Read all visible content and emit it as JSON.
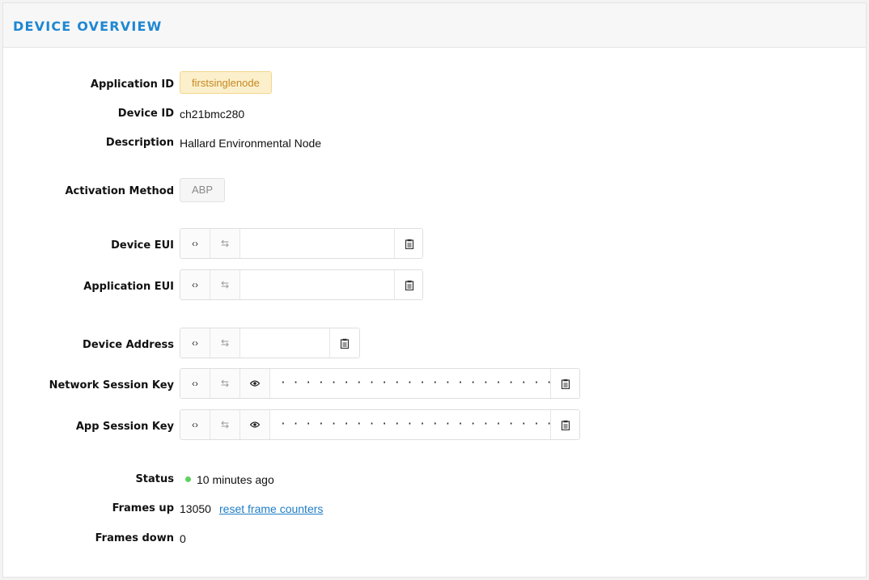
{
  "header": {
    "title": "DEVICE OVERVIEW"
  },
  "fields": {
    "application_id": {
      "label": "Application ID",
      "value": "firstsinglenode"
    },
    "device_id": {
      "label": "Device ID",
      "value": "ch21bmc280"
    },
    "description": {
      "label": "Description",
      "value": "Hallard Environmental Node"
    },
    "activation_method": {
      "label": "Activation Method",
      "value": "ABP"
    },
    "device_eui": {
      "label": "Device EUI",
      "value": ""
    },
    "application_eui": {
      "label": "Application EUI",
      "value": ""
    },
    "device_address": {
      "label": "Device Address",
      "value": ""
    },
    "network_session_key": {
      "label": "Network Session Key",
      "value": "· · · · · · · · · · · · · · · · · · · · · · · · · · · · · · · ·"
    },
    "app_session_key": {
      "label": "App Session Key",
      "value": "· · · · · · · · · · · · · · · · · · · · · · · · · · · · · · · ·"
    },
    "status": {
      "label": "Status",
      "value": "10 minutes ago",
      "color": "#5ed15e"
    },
    "frames_up": {
      "label": "Frames up",
      "value": "13050",
      "link": "reset frame counters"
    },
    "frames_down": {
      "label": "Frames down",
      "value": "0"
    }
  },
  "icons": {
    "code": "‹›",
    "swap": "⇆",
    "eye": "●",
    "copy": "clipboard"
  },
  "colors": {
    "accent": "#1e87d2",
    "badge_text": "#c48a23",
    "link": "#1e7dc8"
  }
}
